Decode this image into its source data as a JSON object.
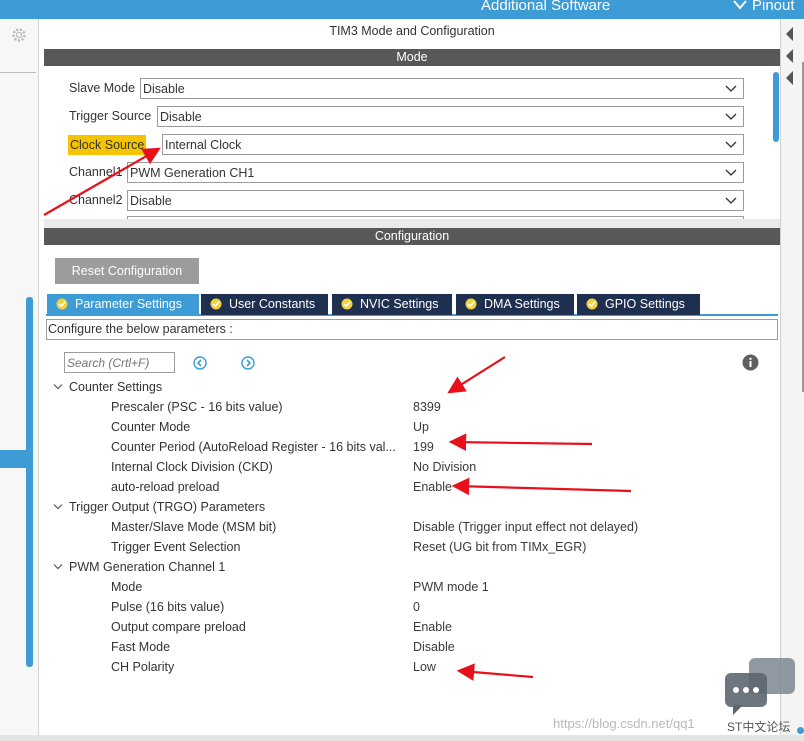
{
  "topbar": {
    "additional_software": "Additional Software",
    "pinout": "Pinout"
  },
  "panel_title": "TIM3 Mode and Configuration",
  "mode_header": "Mode",
  "mode_rows": [
    {
      "label": "Slave Mode",
      "value": "Disable"
    },
    {
      "label": "Trigger Source",
      "value": "Disable"
    },
    {
      "label": "Clock Source",
      "value": "Internal Clock"
    },
    {
      "label": "Channel1",
      "value": "PWM Generation CH1"
    },
    {
      "label": "Channel2",
      "value": "Disable"
    }
  ],
  "config_header": "Configuration",
  "reset_button": "Reset Configuration",
  "tabs": [
    {
      "label": "Parameter Settings"
    },
    {
      "label": "User Constants"
    },
    {
      "label": "NVIC Settings"
    },
    {
      "label": "DMA Settings"
    },
    {
      "label": "GPIO Settings"
    }
  ],
  "instruction": "Configure the below parameters :",
  "search": {
    "placeholder": "Search (Crtl+F)"
  },
  "groups": [
    {
      "title": "Counter Settings",
      "params": [
        {
          "name": "Prescaler (PSC - 16 bits value)",
          "value": "8399"
        },
        {
          "name": "Counter Mode",
          "value": "Up"
        },
        {
          "name": "Counter Period (AutoReload Register - 16 bits val...",
          "value": "199"
        },
        {
          "name": "Internal Clock Division (CKD)",
          "value": "No Division"
        },
        {
          "name": "auto-reload preload",
          "value": "Enable"
        }
      ]
    },
    {
      "title": "Trigger Output (TRGO) Parameters",
      "params": [
        {
          "name": "Master/Slave Mode (MSM bit)",
          "value": "Disable (Trigger input effect not delayed)"
        },
        {
          "name": "Trigger Event Selection",
          "value": "Reset (UG bit from TIMx_EGR)"
        }
      ]
    },
    {
      "title": "PWM Generation Channel 1",
      "params": [
        {
          "name": "Mode",
          "value": "PWM mode 1"
        },
        {
          "name": "Pulse (16 bits value)",
          "value": "0"
        },
        {
          "name": "Output compare preload",
          "value": "Enable"
        },
        {
          "name": "Fast Mode",
          "value": "Disable"
        },
        {
          "name": "CH Polarity",
          "value": "Low"
        }
      ]
    }
  ],
  "watermark": "https://blog.csdn.net/qq1",
  "watermark2": "ST中文论坛",
  "colors": {
    "accent": "#3d9bd6",
    "tab_dark": "#1f2f4f",
    "header": "#585858",
    "highlight": "#f5c400",
    "annotation": "#e8111a"
  },
  "icons": [
    "gear-icon",
    "chevron-down-icon",
    "check-circle-icon",
    "arrow-left-circle-icon",
    "arrow-right-circle-icon",
    "info-icon",
    "chat-icon"
  ]
}
